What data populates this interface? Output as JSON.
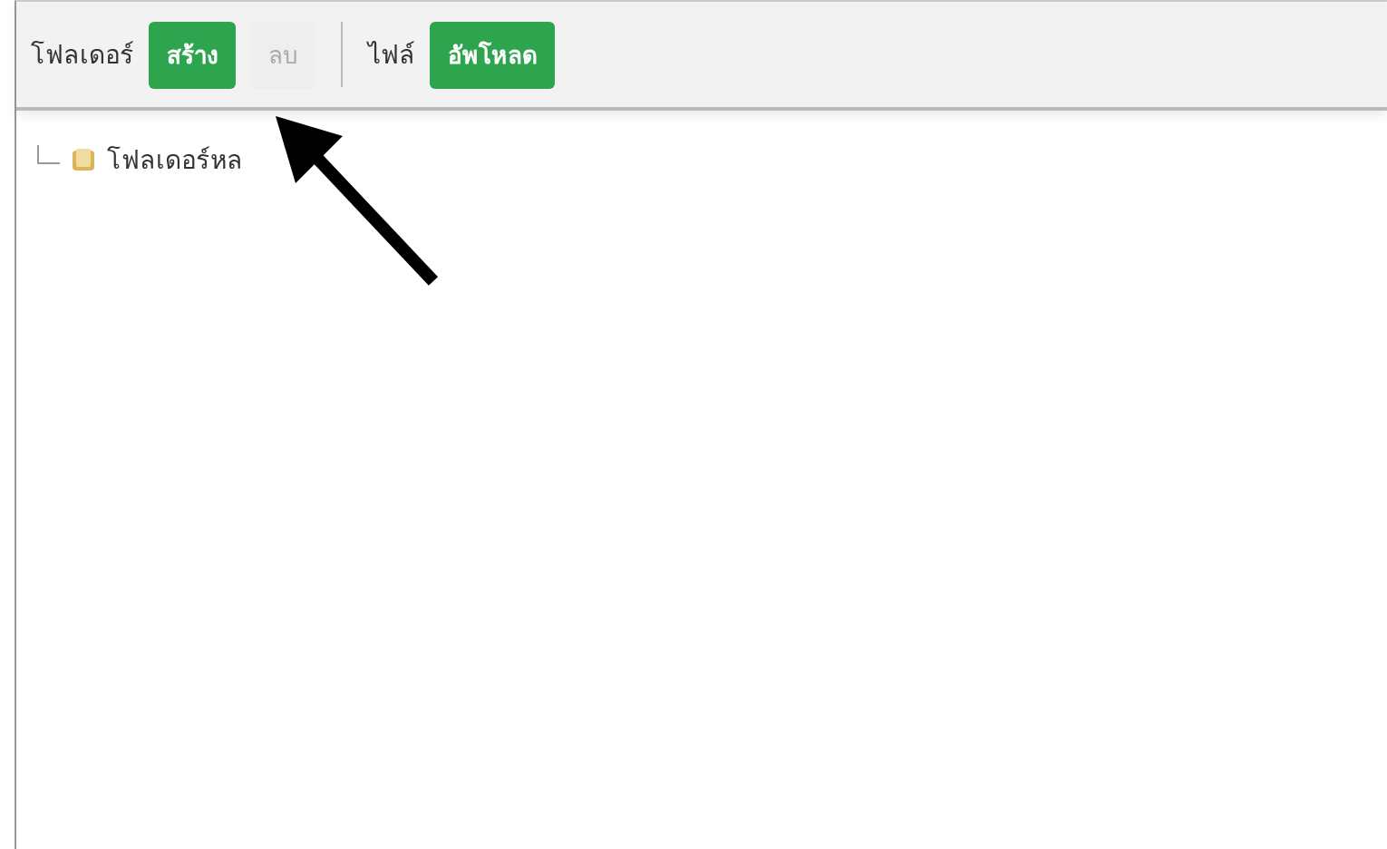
{
  "toolbar": {
    "groups": [
      {
        "label": "โฟลเดอร์",
        "buttons": [
          {
            "label": "สร้าง",
            "disabled": false
          },
          {
            "label": "ลบ",
            "disabled": true
          }
        ]
      },
      {
        "label": "ไฟล์",
        "buttons": [
          {
            "label": "อัพโหลด",
            "disabled": false
          }
        ]
      }
    ]
  },
  "tree": {
    "items": [
      {
        "label": "โฟลเดอร์หล"
      }
    ]
  },
  "annotation": {
    "kind": "arrow"
  }
}
